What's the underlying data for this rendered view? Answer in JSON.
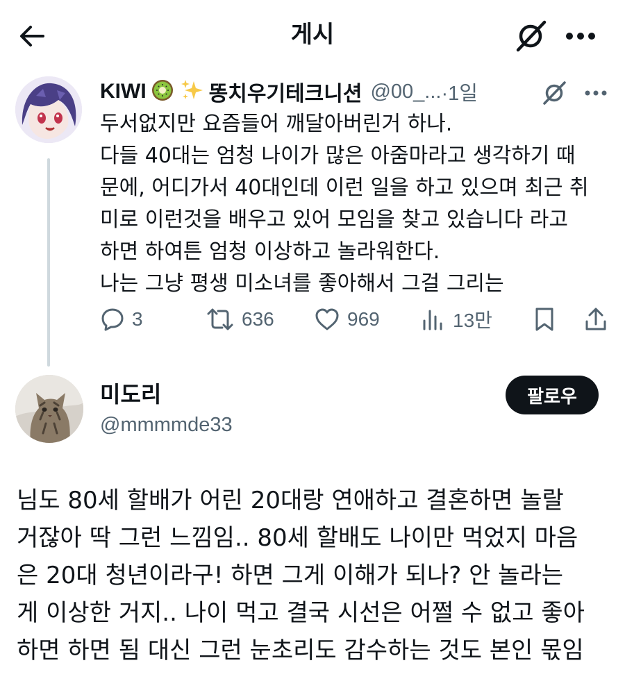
{
  "header": {
    "title": "게시"
  },
  "parent_tweet": {
    "display_name": "KIWI",
    "display_name_suffix": "똥치우기테크니션",
    "handle": "@00_...",
    "time": "·1일",
    "text_lines": [
      "두서없지만 요즘들어 깨달아버린거 하나.",
      "다들 40대는 엄청 나이가 많은 아줌마라고 생각하기 때",
      "문에, 어디가서 40대인데 이런 일을 하고 있으며 최근 취",
      "미로 이런것을 배우고 있어 모임을 찾고 있습니다 라고",
      "하면 하여튼 엄청 이상하고 놀라워한다.",
      "나는 그냥 평생 미소녀를 좋아해서 그걸 그리는"
    ],
    "stats": {
      "replies": "3",
      "retweets": "636",
      "likes": "969",
      "views": "13만"
    }
  },
  "main_tweet": {
    "display_name": "미도리",
    "handle": "@mmmmde33",
    "follow_label": "팔로우",
    "text_lines": [
      "님도 80세 할배가 어린 20대랑 연애하고 결혼하면 놀랄",
      "거잖아 딱 그런 느낌임.. 80세 할배도 나이만 먹었지 마음",
      "은 20대 청년이라구! 하면 그게 이해가 되나? 안 놀라는",
      "게 이상한 거지.. 나이 먹고 결국 시선은 어쩔 수 없고 좋아",
      "하면 하면 됨 대신 그런 눈초리도 감수하는 것도 본인 몫임"
    ]
  },
  "icons": {
    "back": "arrow-left-icon",
    "grok": "grok-slash-icon",
    "more": "more-dots-icon",
    "reply": "reply-bubble-icon",
    "retweet": "retweet-icon",
    "like": "heart-icon",
    "views": "views-bar-icon",
    "bookmark": "bookmark-icon",
    "share": "share-icon"
  }
}
